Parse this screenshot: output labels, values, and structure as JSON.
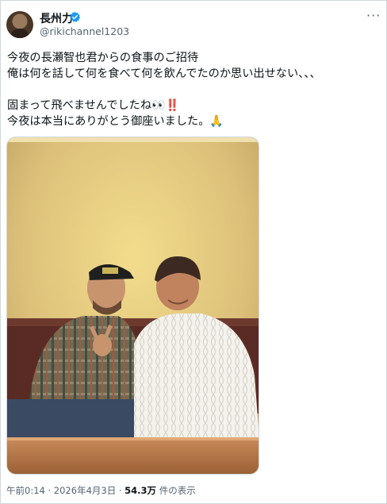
{
  "user": {
    "display_name": "長州力",
    "handle": "@rikichannel1203",
    "verified_icon": "verified-badge-icon",
    "accent_color": "#1d9bf0"
  },
  "tweet": {
    "text": "今夜の長瀬智也君からの食事のご招待\n俺は何を話して何を食べて何を飲んでたのか思い出せない、、、\n\n固まって飛べませんでしたね👀‼️\n今夜は本当にありがとう御座いました。🙏"
  },
  "photo": {
    "icon": "photo"
  },
  "meta": {
    "time": "午前0:14",
    "sep1": " · ",
    "date": "2026年4月3日",
    "sep2": " · ",
    "views_count": "54.3万",
    "views_label": " 件の表示"
  },
  "more_menu": {
    "label": "···"
  }
}
